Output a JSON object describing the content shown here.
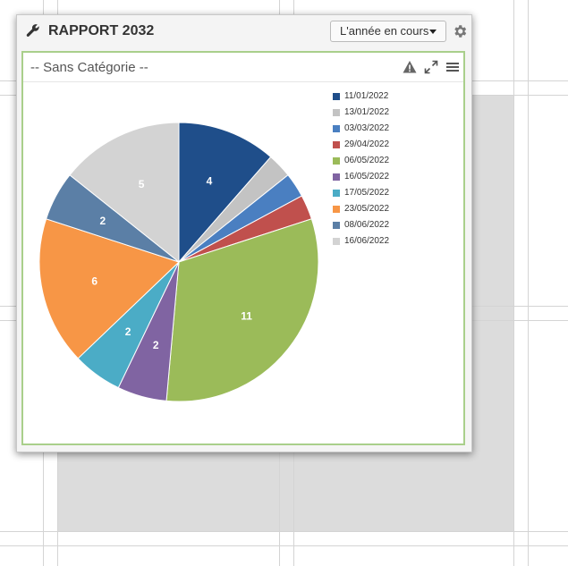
{
  "widget": {
    "title": "RAPPORT 2032",
    "period_label": "L'année en cours",
    "icons": {
      "title": "wrench-icon",
      "settings": "gear-icon",
      "warning": "warning-icon",
      "expand": "expand-icon",
      "menu": "menu-icon"
    }
  },
  "chart_data": {
    "type": "pie",
    "title": "-- Sans Catégorie --",
    "legend_position": "right",
    "categories": [
      "11/01/2022",
      "13/01/2022",
      "03/03/2022",
      "29/04/2022",
      "06/05/2022",
      "16/05/2022",
      "17/05/2022",
      "23/05/2022",
      "08/06/2022",
      "16/06/2022"
    ],
    "values": [
      4,
      1,
      1,
      1,
      11,
      2,
      2,
      6,
      2,
      5
    ],
    "data_labels": [
      "4",
      "",
      "",
      "",
      "11",
      "2",
      "2",
      "6",
      "2",
      "5"
    ],
    "colors": [
      "#1f4e8a",
      "#c3c3c3",
      "#4a7fc1",
      "#c0504d",
      "#9bbb59",
      "#8064a2",
      "#4bacc6",
      "#f79646",
      "#5b7fa6",
      "#d3d3d3"
    ],
    "label_colors": [
      "#ffffff",
      "#ffffff",
      "#ffffff",
      "#ffffff",
      "#ffffff",
      "#ffffff",
      "#ffffff",
      "#ffffff",
      "#ffffff",
      "#ffffff"
    ]
  }
}
